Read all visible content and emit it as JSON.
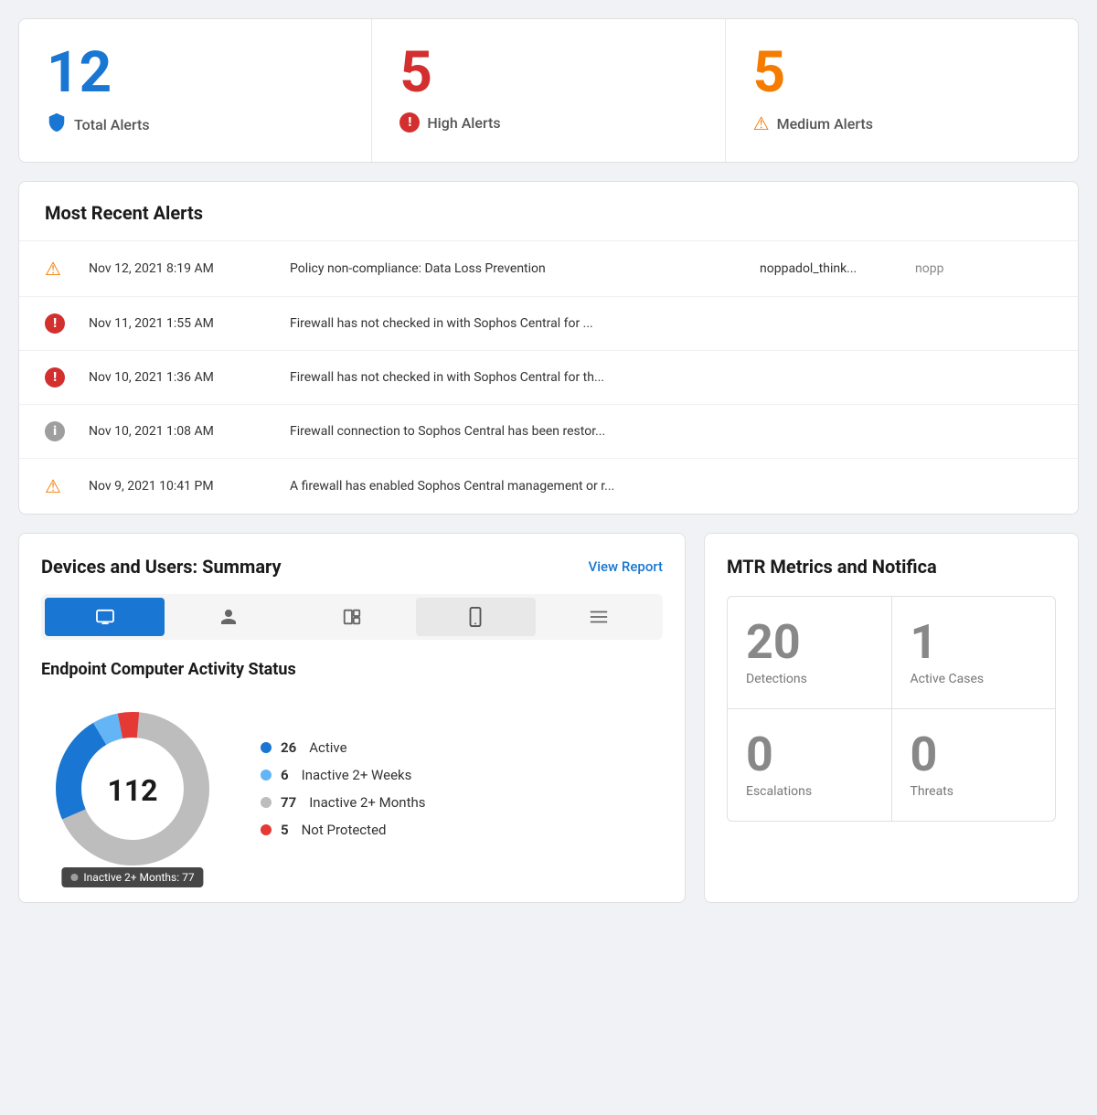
{
  "alerts": {
    "total": {
      "number": "12",
      "label": "Total Alerts",
      "color": "blue",
      "icon": "shield"
    },
    "high": {
      "number": "5",
      "label": "High Alerts",
      "color": "red",
      "icon": "exclaim-red"
    },
    "medium": {
      "number": "5",
      "label": "Medium Alerts",
      "color": "orange",
      "icon": "warn-orange"
    }
  },
  "recent_alerts": {
    "title": "Most Recent Alerts",
    "rows": [
      {
        "icon_type": "warn",
        "datetime": "Nov 12, 2021 8:19 AM",
        "message": "Policy non-compliance: Data Loss Prevention",
        "user": "noppadol_think..."
      },
      {
        "icon_type": "exclaim-red",
        "datetime": "Nov 11, 2021 1:55 AM",
        "message": "Firewall has not checked in with Sophos Central for ...",
        "user": ""
      },
      {
        "icon_type": "exclaim-red",
        "datetime": "Nov 10, 2021 1:36 AM",
        "message": "Firewall has not checked in with Sophos Central for th...",
        "user": ""
      },
      {
        "icon_type": "info",
        "datetime": "Nov 10, 2021 1:08 AM",
        "message": "Firewall connection to Sophos Central has been restor...",
        "user": ""
      },
      {
        "icon_type": "warn",
        "datetime": "Nov 9, 2021 10:41 PM",
        "message": "A firewall has enabled Sophos Central management or r...",
        "user": ""
      }
    ]
  },
  "devices_summary": {
    "title": "Devices and Users: Summary",
    "view_report": "View Report",
    "tabs": [
      {
        "icon": "🖥",
        "label": "desktop",
        "active": true
      },
      {
        "icon": "👤",
        "label": "user",
        "active": false
      },
      {
        "icon": "🖥",
        "label": "server",
        "active": false
      },
      {
        "icon": "📱",
        "label": "mobile",
        "active": false,
        "selected_light": true
      },
      {
        "icon": "≡",
        "label": "list",
        "active": false
      }
    ],
    "endpoint": {
      "title": "Endpoint Computer Activity Status",
      "total": "112",
      "tooltip": "Inactive 2+ Months: 77",
      "legend": [
        {
          "color": "#1976d2",
          "count": "26",
          "label": "Active"
        },
        {
          "color": "#64b5f6",
          "count": "6",
          "label": "Inactive 2+ Weeks"
        },
        {
          "color": "#bdbdbd",
          "count": "77",
          "label": "Inactive 2+ Months"
        },
        {
          "color": "#e53935",
          "count": "5",
          "label": "Not Protected"
        }
      ]
    }
  },
  "mtr_metrics": {
    "title": "MTR Metrics and Notifica",
    "cells": [
      {
        "number": "20",
        "label": "Detections"
      },
      {
        "number": "1",
        "label": "Active Cases"
      },
      {
        "number": "0",
        "label": "Escalations"
      },
      {
        "number": "0",
        "label": "Threats"
      }
    ]
  }
}
